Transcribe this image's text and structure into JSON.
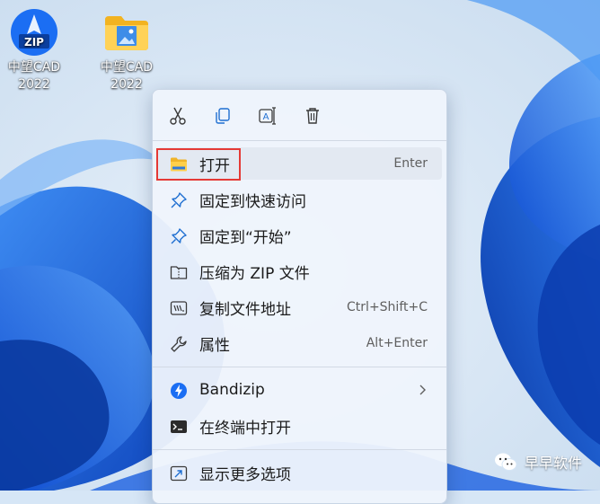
{
  "desktop": {
    "icons": [
      {
        "label_line1": "中望CAD",
        "label_line2": "2022",
        "icon": "zip-archive-icon",
        "badge": "ZIP"
      },
      {
        "label_line1": "中望CAD",
        "label_line2": "2022",
        "icon": "folder-icon"
      }
    ]
  },
  "context_menu": {
    "toolbar": [
      {
        "name": "cut",
        "icon": "scissors-icon"
      },
      {
        "name": "copy",
        "icon": "copy-icon"
      },
      {
        "name": "rename",
        "icon": "rename-icon"
      },
      {
        "name": "delete",
        "icon": "trash-icon"
      }
    ],
    "items": [
      {
        "label": "打开",
        "shortcut": "Enter",
        "icon": "folder-open-icon"
      },
      {
        "label": "固定到快速访问",
        "icon": "pin-icon"
      },
      {
        "label": "固定到“开始”",
        "icon": "pin-icon"
      },
      {
        "label": "压缩为 ZIP 文件",
        "icon": "zip-folder-icon"
      },
      {
        "label": "复制文件地址",
        "shortcut": "Ctrl+Shift+C",
        "icon": "copy-path-icon"
      },
      {
        "label": "属性",
        "shortcut": "Alt+Enter",
        "icon": "wrench-icon"
      },
      {
        "label": "Bandizip",
        "icon": "bandizip-icon",
        "has_submenu": true
      },
      {
        "label": "在终端中打开",
        "icon": "terminal-icon"
      },
      {
        "label": "显示更多选项",
        "icon": "show-more-icon"
      }
    ]
  },
  "watermark": {
    "text": "早早软件",
    "icon": "wechat-icon"
  },
  "colors": {
    "accent": "#1a73e8",
    "highlight_border": "#e53935",
    "menu_bg": "#eff4fc"
  }
}
